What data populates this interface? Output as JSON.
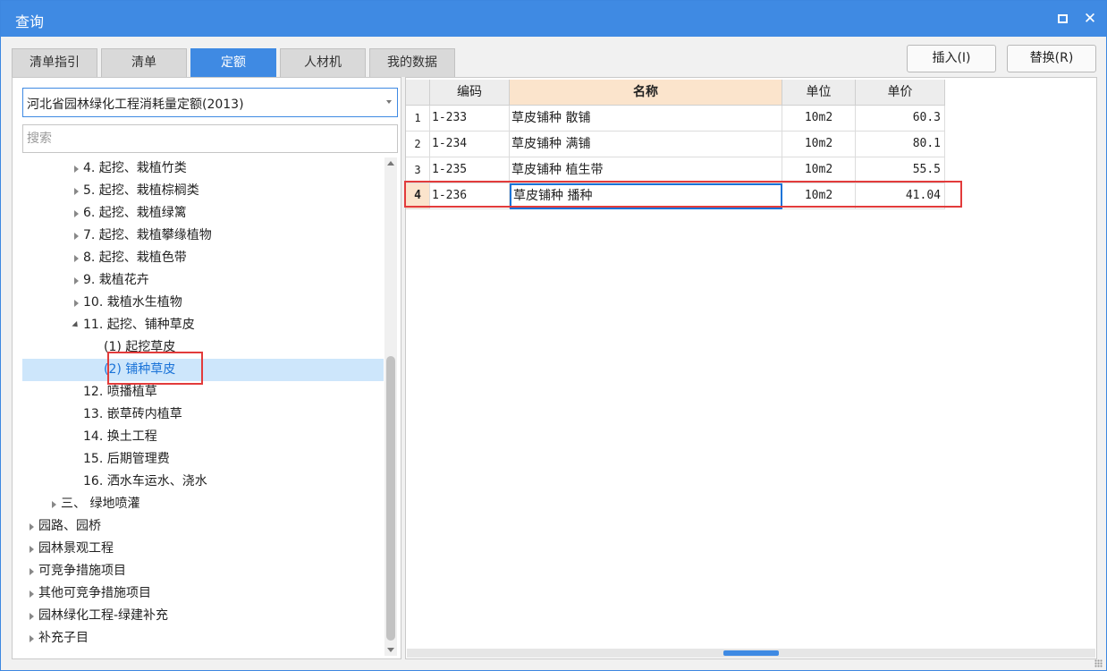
{
  "window": {
    "title": "查询",
    "maximize_icon": "maximize-icon",
    "close_icon": "close-icon",
    "title_bar_color": "#3f8ae3"
  },
  "tabs": [
    {
      "label": "清单指引",
      "active": false
    },
    {
      "label": "清单",
      "active": false
    },
    {
      "label": "定额",
      "active": true
    },
    {
      "label": "人材机",
      "active": false
    },
    {
      "label": "我的数据",
      "active": false
    }
  ],
  "actions": {
    "insert_label": "插入(I)",
    "replace_label": "替换(R)"
  },
  "left": {
    "library_select": "河北省园林绿化工程消耗量定额(2013)",
    "search_placeholder": "搜索",
    "search_value": "",
    "tree": [
      {
        "label": "4. 起挖、栽植竹类",
        "level": 2,
        "expander": "collapsed"
      },
      {
        "label": "5. 起挖、栽植棕榈类",
        "level": 2,
        "expander": "collapsed"
      },
      {
        "label": "6. 起挖、栽植绿篱",
        "level": 2,
        "expander": "collapsed"
      },
      {
        "label": "7. 起挖、栽植攀缘植物",
        "level": 2,
        "expander": "collapsed"
      },
      {
        "label": "8. 起挖、栽植色带",
        "level": 2,
        "expander": "collapsed"
      },
      {
        "label": "9. 栽植花卉",
        "level": 2,
        "expander": "collapsed"
      },
      {
        "label": "10. 栽植水生植物",
        "level": 2,
        "expander": "collapsed"
      },
      {
        "label": "11. 起挖、铺种草皮",
        "level": 2,
        "expander": "expanded"
      },
      {
        "label": "(1) 起挖草皮",
        "level": 3,
        "expander": "none"
      },
      {
        "label": "(2) 铺种草皮",
        "level": 3,
        "expander": "none",
        "selected": true
      },
      {
        "label": "12. 喷播植草",
        "level": 2,
        "expander": "none"
      },
      {
        "label": "13. 嵌草砖内植草",
        "level": 2,
        "expander": "none"
      },
      {
        "label": "14. 换土工程",
        "level": 2,
        "expander": "none"
      },
      {
        "label": "15. 后期管理费",
        "level": 2,
        "expander": "none"
      },
      {
        "label": "16. 洒水车运水、浇水",
        "level": 2,
        "expander": "none"
      },
      {
        "label": "三、 绿地喷灌",
        "level": 1,
        "expander": "collapsed"
      },
      {
        "label": "园路、园桥",
        "level": 0,
        "expander": "collapsed"
      },
      {
        "label": "园林景观工程",
        "level": 0,
        "expander": "collapsed"
      },
      {
        "label": "可竞争措施项目",
        "level": 0,
        "expander": "collapsed"
      },
      {
        "label": "其他可竞争措施项目",
        "level": 0,
        "expander": "collapsed"
      },
      {
        "label": "园林绿化工程-绿建补充",
        "level": 0,
        "expander": "collapsed"
      },
      {
        "label": "补充子目",
        "level": 0,
        "expander": "collapsed"
      }
    ]
  },
  "table": {
    "headers": {
      "code": "编码",
      "name": "名称",
      "unit": "单位",
      "price": "单价"
    },
    "rows": [
      {
        "num": "1",
        "code": "1-233",
        "name": "草皮铺种 散铺",
        "unit": "10m2",
        "price": "60.3"
      },
      {
        "num": "2",
        "code": "1-234",
        "name": "草皮铺种 满铺",
        "unit": "10m2",
        "price": "80.1"
      },
      {
        "num": "3",
        "code": "1-235",
        "name": "草皮铺种 植生带",
        "unit": "10m2",
        "price": "55.5"
      },
      {
        "num": "4",
        "code": "1-236",
        "name": "草皮铺种 播种",
        "unit": "10m2",
        "price": "41.04",
        "current": true
      }
    ]
  },
  "colors": {
    "accent": "#3f8ae3",
    "selection": "#cde6fb",
    "header_highlight": "#fbe4cc",
    "annotation_red": "#e23b3b"
  }
}
